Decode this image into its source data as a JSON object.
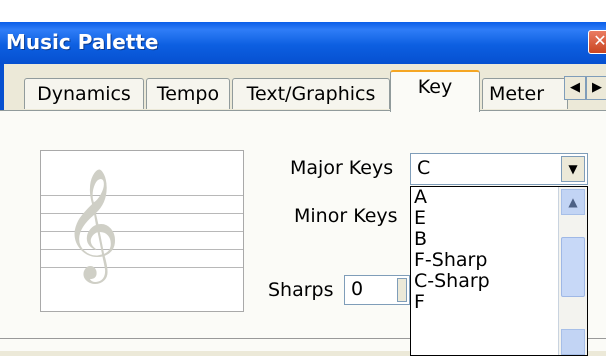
{
  "window": {
    "title": "Music Palette",
    "close_label": "✕"
  },
  "tabs": [
    {
      "label": "Dynamics"
    },
    {
      "label": "Tempo"
    },
    {
      "label": "Text/Graphics"
    },
    {
      "label": "Key"
    },
    {
      "label": "Meter"
    }
  ],
  "tab_scroll": {
    "left": "◀",
    "right": "▶"
  },
  "key_panel": {
    "clef_symbol": "𝄞",
    "major_label": "Major Keys",
    "major_value": "C",
    "minor_label": "Minor Keys",
    "sharps_label": "Sharps",
    "sharps_value": "0",
    "dropdown_items": [
      "A",
      "E",
      "B",
      "F-Sharp",
      "C-Sharp",
      "F"
    ]
  }
}
